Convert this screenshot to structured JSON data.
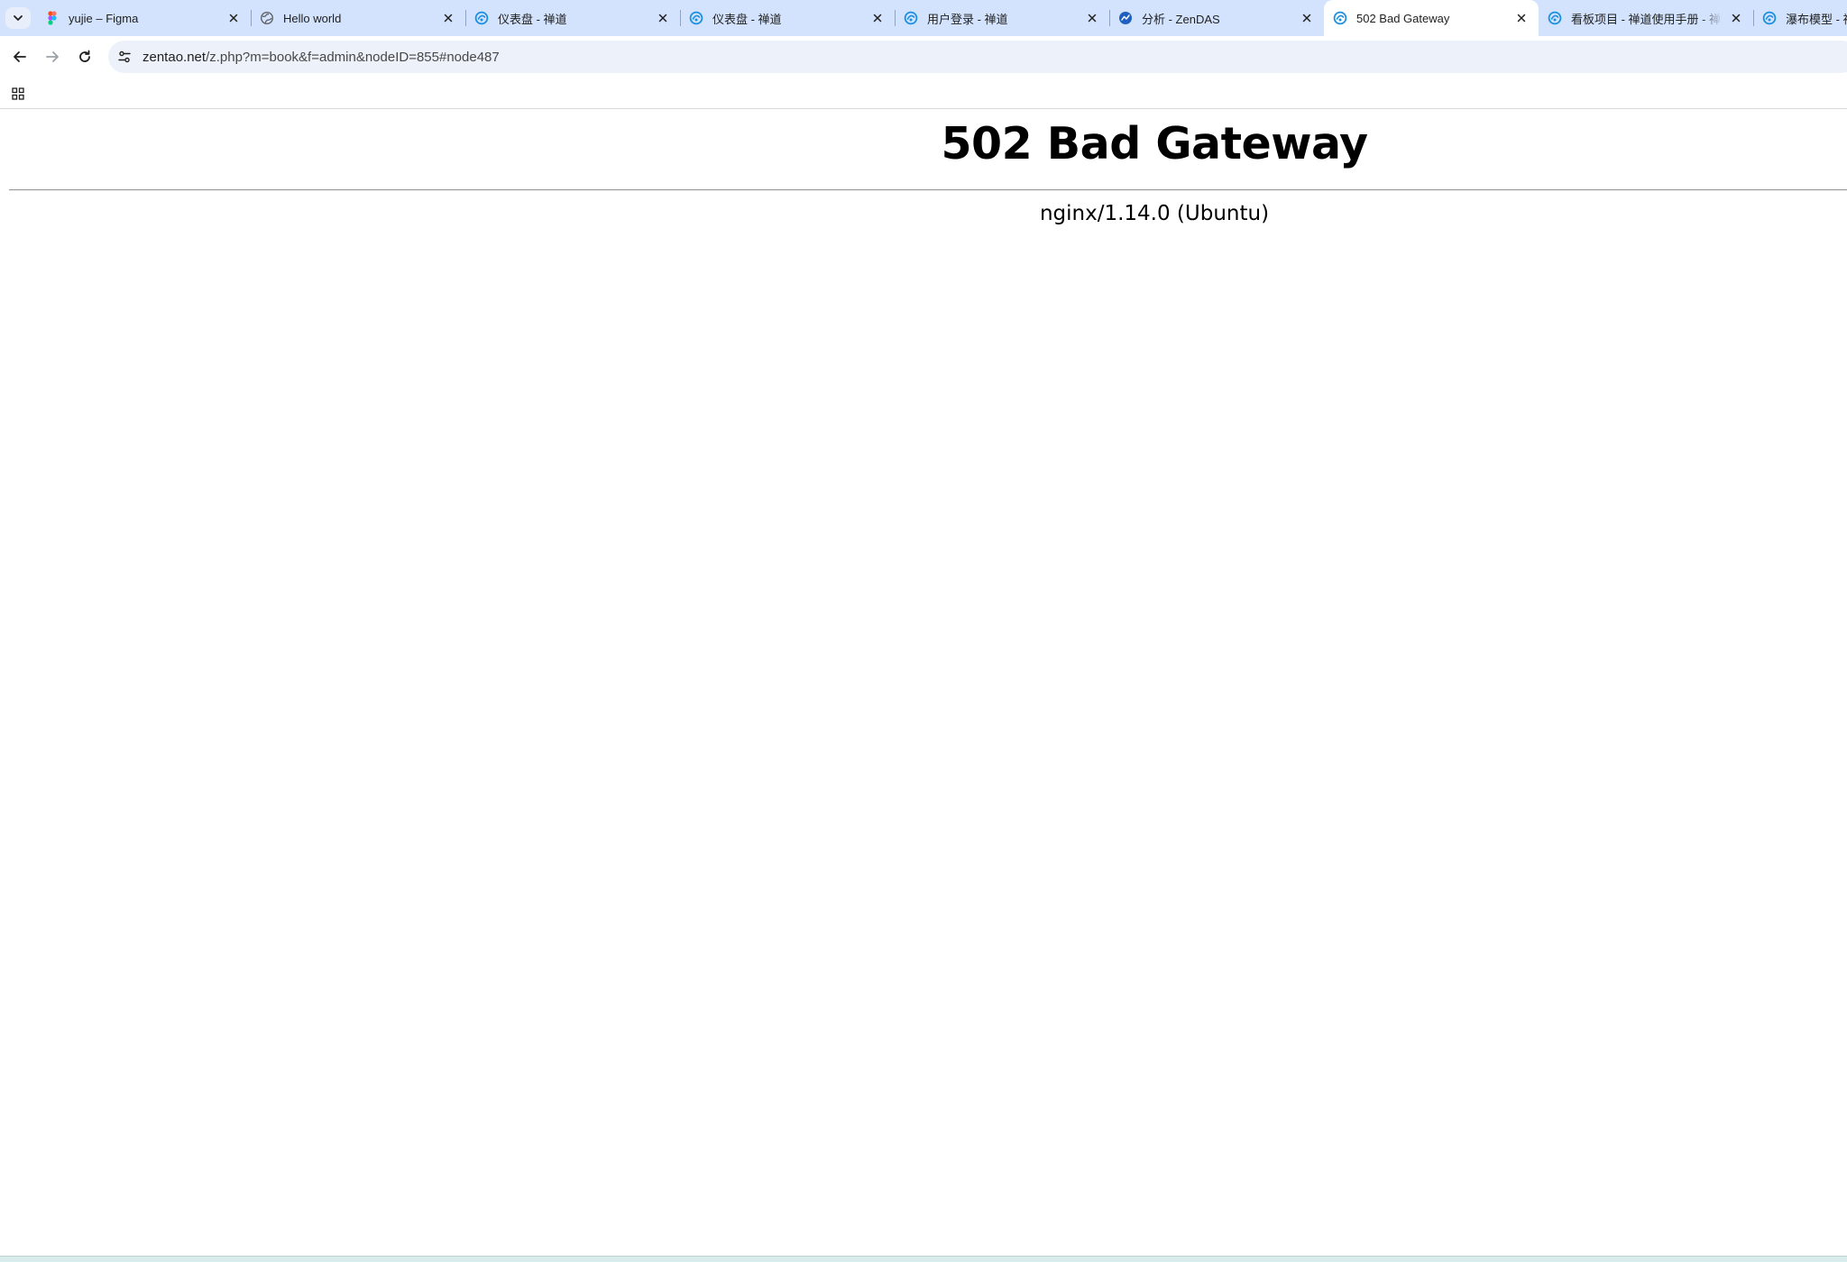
{
  "browser": {
    "tabs": [
      {
        "title": "yujie – Figma",
        "favicon": "figma-icon",
        "active": false
      },
      {
        "title": "Hello world",
        "favicon": "globe-icon",
        "active": false
      },
      {
        "title": "仪表盘 - 禅道",
        "favicon": "zentao-icon",
        "active": false
      },
      {
        "title": "仪表盘 - 禅道",
        "favicon": "zentao-icon",
        "active": false
      },
      {
        "title": "用户登录 - 禅道",
        "favicon": "zentao-icon",
        "active": false
      },
      {
        "title": "分析 - ZenDAS",
        "favicon": "zendas-icon",
        "active": false
      },
      {
        "title": "502 Bad Gateway",
        "favicon": "zentao-icon",
        "active": true
      },
      {
        "title": "看板项目 - 禅道使用手册 - 禅道",
        "favicon": "zentao-icon",
        "active": false
      },
      {
        "title": "瀑布模型 - 禅道",
        "favicon": "zentao-icon",
        "active": false
      }
    ],
    "address": {
      "host": "zentao.net",
      "path": "/z.php?m=book&f=admin&nodeID=855#node487"
    }
  },
  "page": {
    "heading": "502 Bad Gateway",
    "server": "nginx/1.14.0 (Ubuntu)"
  },
  "colors": {
    "tabstrip": "#d3e3fd",
    "omnibox": "#edf2fa",
    "zentao_blue": "#1a8fe0",
    "figma_red": "#f24e1e"
  }
}
